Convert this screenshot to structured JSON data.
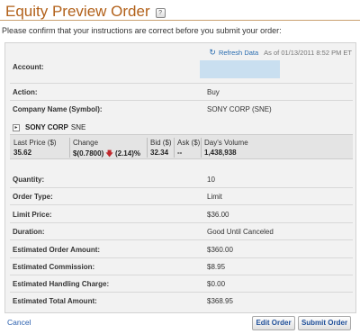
{
  "header": {
    "title": "Equity Preview Order",
    "help_icon": "help-icon",
    "help_glyph": "?"
  },
  "instructions": "Please confirm that your instructions are correct before you submit your order:",
  "refresh": {
    "icon": "refresh-icon",
    "label": "Refresh Data",
    "as_of": "As of 01/13/2011 8:52 PM ET"
  },
  "order": {
    "account": {
      "label": "Account:",
      "value": ""
    },
    "action": {
      "label": "Action:",
      "value": "Buy"
    },
    "company": {
      "label": "Company Name (Symbol):",
      "value": "SONY CORP (SNE)"
    },
    "quantity": {
      "label": "Quantity:",
      "value": "10"
    },
    "order_type": {
      "label": "Order Type:",
      "value": "Limit"
    },
    "limit_price": {
      "label": "Limit Price:",
      "value": "$36.00"
    },
    "duration": {
      "label": "Duration:",
      "value": "Good Until Canceled"
    },
    "est_amount": {
      "label": "Estimated Order Amount:",
      "value": "$360.00"
    },
    "est_commission": {
      "label": "Estimated Commission:",
      "value": "$8.95"
    },
    "est_handling": {
      "label": "Estimated Handling Charge:",
      "value": "$0.00"
    },
    "est_total": {
      "label": "Estimated Total Amount:",
      "value": "$368.95"
    }
  },
  "symbol": {
    "toggle_glyph": "▸",
    "name": "SONY CORP",
    "ticker": "SNE"
  },
  "quote": {
    "last_price": {
      "label": "Last Price ($)",
      "value": "35.62"
    },
    "change": {
      "label": "Change",
      "value": "$(0.7800)",
      "pct": "(2.14)%",
      "direction_icon": "down-arrow-icon"
    },
    "bid": {
      "label": "Bid ($)",
      "value": "32.34"
    },
    "ask": {
      "label": "Ask ($)",
      "value": "--"
    },
    "volume": {
      "label": "Day's Volume",
      "value": "1,438,938"
    }
  },
  "colors": {
    "title": "#b2611a",
    "negative": "#b21f1f",
    "link": "#2a5fae"
  },
  "actions": {
    "cancel": "Cancel",
    "edit": "Edit Order",
    "submit": "Submit Order"
  }
}
